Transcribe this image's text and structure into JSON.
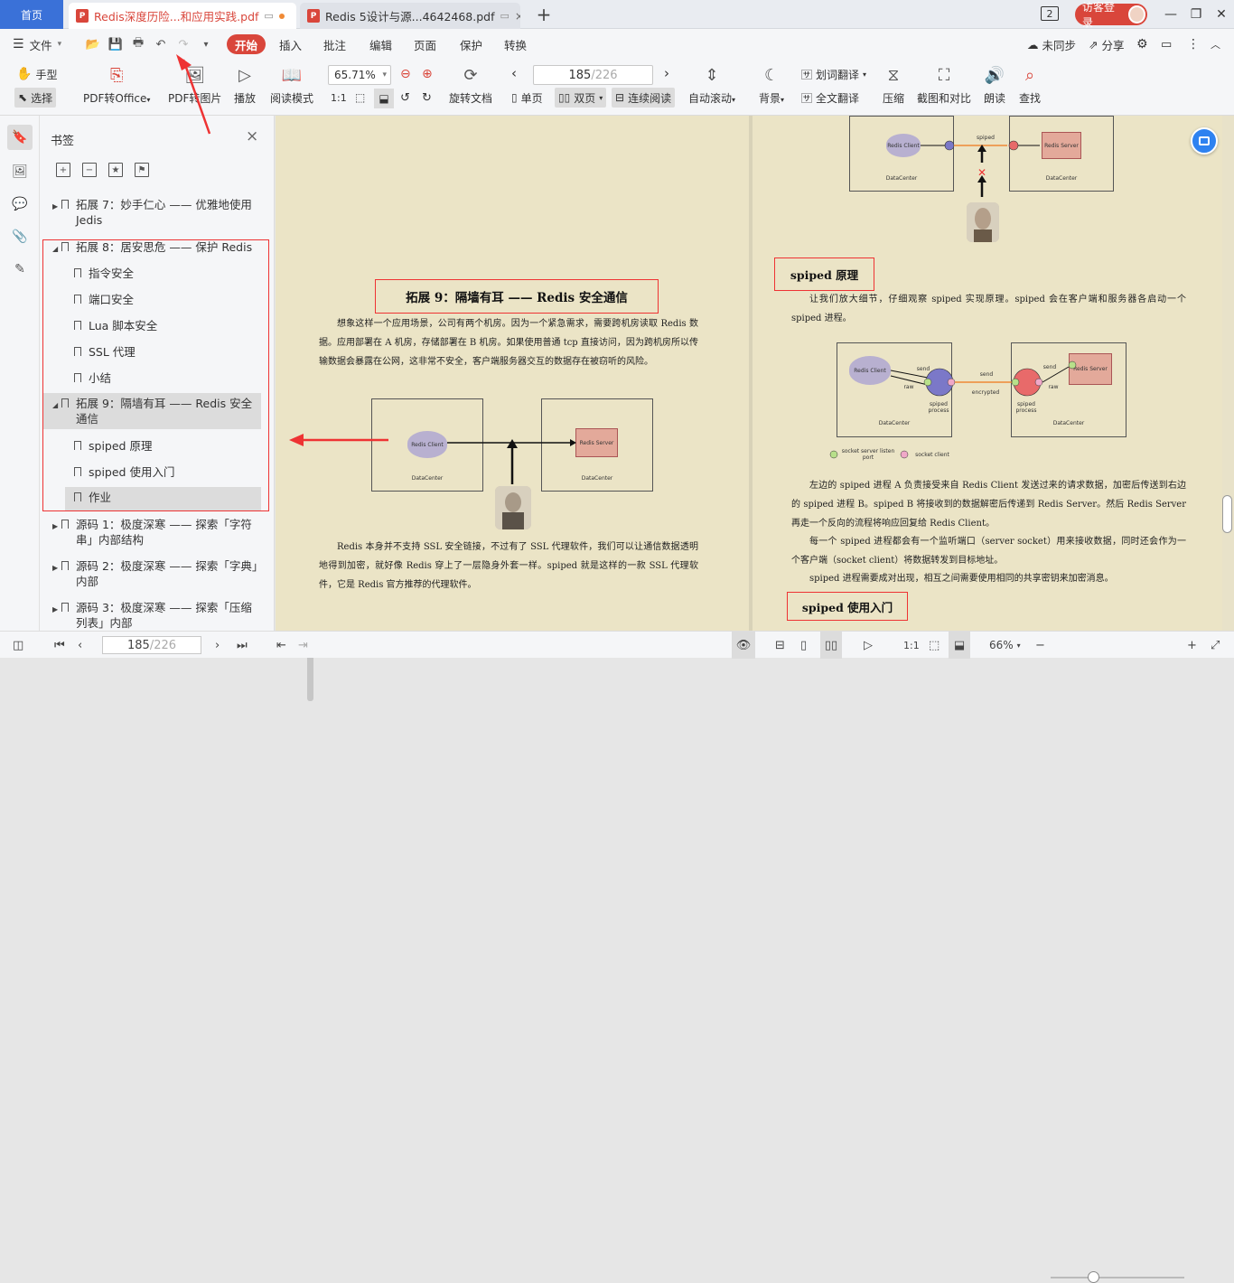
{
  "titlebar": {
    "home": "首页",
    "tab_active": "Redis深度历险...和应用实践.pdf",
    "tab_inactive": "Redis 5设计与源...4642468.pdf",
    "window_count": "2",
    "login": "访客登录"
  },
  "menubar": {
    "file": "文件",
    "items": [
      "开始",
      "插入",
      "批注",
      "编辑",
      "页面",
      "保护",
      "转换"
    ],
    "sync": "未同步",
    "share": "分享"
  },
  "toolbar": {
    "hand": "手型",
    "select": "选择",
    "pdf_to_office": "PDF转Office",
    "pdf_to_image": "PDF转图片",
    "play": "播放",
    "read_mode": "阅读模式",
    "zoom": "65.71%",
    "rotate_doc": "旋转文档",
    "page_current": "185",
    "page_total": "/226",
    "single": "单页",
    "double": "双页",
    "continuous": "连续阅读",
    "auto_scroll": "自动滚动",
    "background": "背景",
    "translate_select": "划词翻译",
    "translate_full": "全文翻译",
    "compress": "压缩",
    "screenshot": "截图和对比",
    "read_aloud": "朗读",
    "find": "查找"
  },
  "bookmarks": {
    "title": "书签",
    "items": [
      {
        "label": "拓展 7：妙手仁心 —— 优雅地使用 Jedis",
        "level": 0,
        "arrow": "▶"
      },
      {
        "label": "拓展 8：居安思危 —— 保护 Redis",
        "level": 0,
        "arrow": "◢"
      },
      {
        "label": "指令安全",
        "level": 1,
        "arrow": ""
      },
      {
        "label": "端口安全",
        "level": 1,
        "arrow": ""
      },
      {
        "label": "Lua 脚本安全",
        "level": 1,
        "arrow": ""
      },
      {
        "label": "SSL 代理",
        "level": 1,
        "arrow": ""
      },
      {
        "label": "小结",
        "level": 1,
        "arrow": ""
      },
      {
        "label": "拓展 9：隔墙有耳 —— Redis 安全通信",
        "level": 0,
        "arrow": "◢"
      },
      {
        "label": "spiped 原理",
        "level": 1,
        "arrow": ""
      },
      {
        "label": "spiped 使用入门",
        "level": 1,
        "arrow": ""
      },
      {
        "label": "作业",
        "level": 1,
        "arrow": ""
      },
      {
        "label": "源码 1：极度深寒 —— 探索「字符串」内部结构",
        "level": 0,
        "arrow": "▶"
      },
      {
        "label": "源码 2：极度深寒 —— 探索「字典」内部",
        "level": 0,
        "arrow": "▶"
      },
      {
        "label": "源码 3：极度深寒 —— 探索「压缩列表」内部",
        "level": 0,
        "arrow": "▶"
      }
    ]
  },
  "page_left": {
    "heading": "拓展 9：隔墙有耳 —— Redis 安全通信",
    "para1": "想象这样一个应用场景，公司有两个机房。因为一个紧急需求，需要跨机房读取 Redis 数据。应用部署在 A 机房，存储部署在 B 机房。如果使用普通 tcp 直接访问，因为跨机房所以传输数据会暴露在公网，这非常不安全，客户端服务器交互的数据存在被窃听的风险。",
    "para2": "Redis 本身并不支持 SSL 安全链接，不过有了 SSL 代理软件，我们可以让通信数据透明地得到加密，就好像 Redis 穿上了一层隐身外套一样。spiped 就是这样的一款 SSL 代理软件，它是 Redis 官方推荐的代理软件。",
    "diagram": {
      "client": "Redis Client",
      "server": "Redis Server",
      "dc": "DataCenter"
    }
  },
  "page_right": {
    "heading1": "spiped 原理",
    "para1": "让我们放大细节，仔细观察 spiped 实现原理。spiped 会在客户端和服务器各启动一个 spiped 进程。",
    "para2": "左边的 spiped 进程 A 负责接受来自 Redis Client 发送过来的请求数据，加密后传送到右边的 spiped 进程 B。spiped B 将接收到的数据解密后传递到 Redis Server。然后 Redis Server 再走一个反向的流程将响应回复给 Redis Client。",
    "para3": "每一个 spiped 进程都会有一个监听端口（server socket）用来接收数据，同时还会作为一个客户端（socket client）将数据转发到目标地址。",
    "para4": "spiped 进程需要成对出现，相互之间需要使用相同的共享密钥来加密消息。",
    "heading2": "spiped 使用入门",
    "top_diagram": {
      "client": "Redis Client",
      "server": "Redis Server",
      "spiped": "spiped",
      "dc": "DataCenter"
    },
    "diagram": {
      "client": "Redis Client",
      "server": "Redis Server",
      "send": "send",
      "raw": "raw",
      "encrypted": "encrypted",
      "process": "spiped process",
      "dc": "DataCenter",
      "legend_server": "socket server listen port",
      "legend_client": "socket client"
    }
  },
  "statusbar": {
    "page_current": "185",
    "page_total": "/226",
    "zoom": "66%"
  }
}
